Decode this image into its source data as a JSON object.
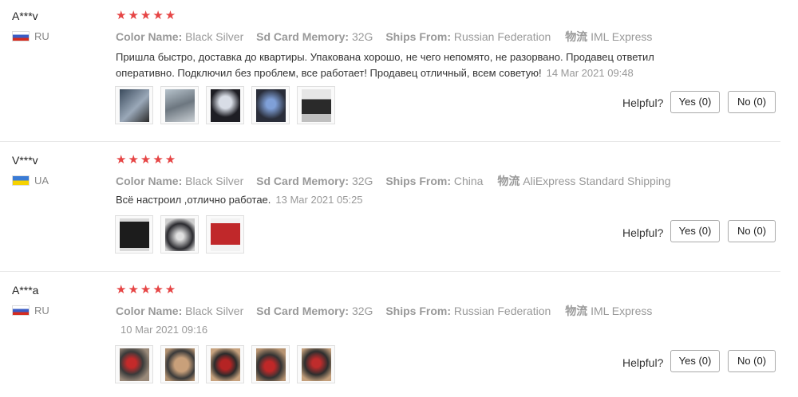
{
  "labels": {
    "color_name": "Color Name:",
    "sd_card": "Sd Card Memory:",
    "ships_from": "Ships From:",
    "logistics": "物流",
    "helpful": "Helpful?",
    "yes": "Yes (0)",
    "no": "No (0)",
    "stars": "★★★★★"
  },
  "reviews": [
    {
      "user": "A***v",
      "country": "RU",
      "rating": 5,
      "color": "Black Silver",
      "sd": "32G",
      "ships": "Russian Federation",
      "shipping": "IML Express",
      "text": "Пришла быстро, доставка до квартиры. Упакована хорошо, не чего непомято, не разорвано. Продавец ответил оперативно. Подключил без проблем, все работает! Продавец отличный, всем советую!",
      "date": "14 Mar 2021 09:48",
      "photo_count": 5
    },
    {
      "user": "V***v",
      "country": "UA",
      "rating": 5,
      "color": "Black Silver",
      "sd": "32G",
      "ships": "China",
      "shipping": "AliExpress Standard Shipping",
      "text": "Всё настроил ,отлично работае.",
      "date": "13 Mar 2021 05:25",
      "photo_count": 3
    },
    {
      "user": "A***a",
      "country": "RU",
      "rating": 5,
      "color": "Black Silver",
      "sd": "32G",
      "ships": "Russian Federation",
      "shipping": "IML Express",
      "text": "",
      "date": "10 Mar 2021 09:16",
      "photo_count": 5
    }
  ],
  "colors": {
    "star": "#e64545",
    "border": "#aaaaaa",
    "muted": "#999999"
  }
}
